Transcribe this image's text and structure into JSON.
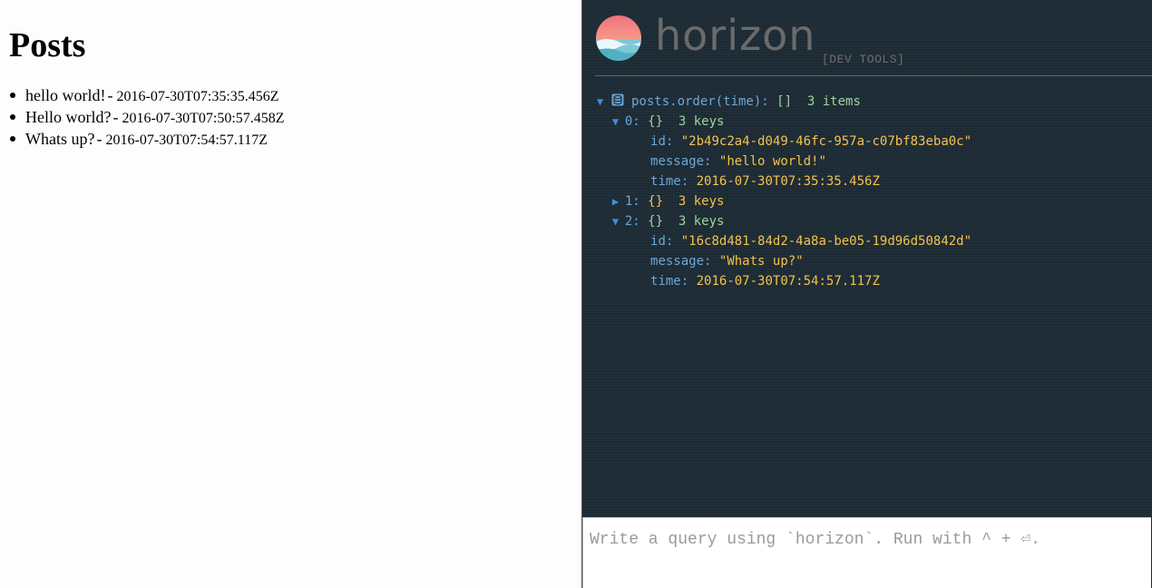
{
  "app": {
    "title": "Posts",
    "posts": [
      {
        "message": "hello world!",
        "sep": "-",
        "time": "2016-07-30T07:35:35.456Z"
      },
      {
        "message": "Hello world?",
        "sep": "-",
        "time": "2016-07-30T07:50:57.458Z"
      },
      {
        "message": "Whats up?",
        "sep": "-",
        "time": "2016-07-30T07:54:57.117Z"
      }
    ]
  },
  "devtools": {
    "brand": "horizon",
    "subtitle": "[DEV TOOLS]",
    "colors": {
      "background": "#1e2c36",
      "key": "#6ca7d6",
      "meta": "#9dd39d",
      "string": "#f4c24d",
      "arrow": "#3b8fd9"
    },
    "tree": {
      "root": {
        "arrow": "▼",
        "query": "posts.order(time):",
        "type": "[]",
        "count": "3 items"
      },
      "items": [
        {
          "arrow": "▼",
          "index": "0:",
          "type": "{}",
          "count": "3 keys",
          "fields": [
            {
              "key": "id:",
              "value": "\"2b49c2a4-d049-46fc-957a-c07bf83eba0c\""
            },
            {
              "key": "message:",
              "value": "\"hello world!\""
            },
            {
              "key": "time:",
              "value": "2016-07-30T07:35:35.456Z"
            }
          ]
        },
        {
          "arrow": "▶",
          "index": "1:",
          "type": "{}",
          "count": "3 keys",
          "fields": []
        },
        {
          "arrow": "▼",
          "index": "2:",
          "type": "{}",
          "count": "3 keys",
          "fields": [
            {
              "key": "id:",
              "value": "\"16c8d481-84d2-4a8a-be05-19d96d50842d\""
            },
            {
              "key": "message:",
              "value": "\"Whats up?\""
            },
            {
              "key": "time:",
              "value": "2016-07-30T07:54:57.117Z"
            }
          ]
        }
      ]
    },
    "query_input": {
      "value": "",
      "placeholder": "Write a query using `horizon`. Run with ^ + ⏎."
    }
  }
}
